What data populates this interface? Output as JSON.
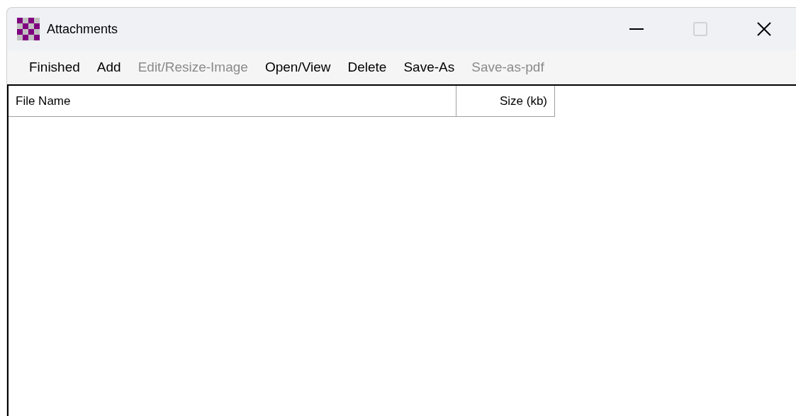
{
  "window": {
    "title": "Attachments",
    "controls": [
      {
        "kind": "minimize",
        "disabled": false
      },
      {
        "kind": "maximize",
        "disabled": true
      },
      {
        "kind": "close",
        "disabled": false
      }
    ]
  },
  "menu": [
    {
      "label": "Finished",
      "disabled": false
    },
    {
      "label": "Add",
      "disabled": false
    },
    {
      "label": "Edit/Resize-Image",
      "disabled": true
    },
    {
      "label": "Open/View",
      "disabled": false
    },
    {
      "label": "Delete",
      "disabled": false
    },
    {
      "label": "Save-As",
      "disabled": false
    },
    {
      "label": "Save-as-pdf",
      "disabled": true
    }
  ],
  "table": {
    "columns": [
      {
        "label": "File Name"
      },
      {
        "label": "Size (kb)"
      }
    ]
  }
}
